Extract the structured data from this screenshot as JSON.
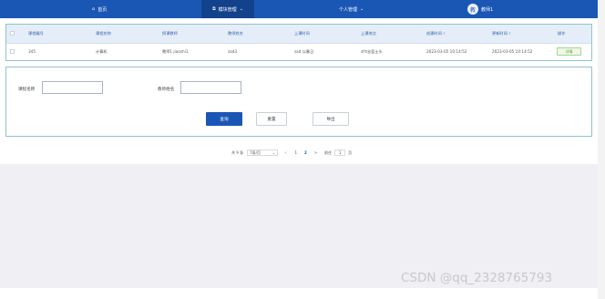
{
  "nav": {
    "home": "首页",
    "module": "模块管理",
    "personal": "个人管理",
    "avatar_initial": "教",
    "user": "教师1"
  },
  "table": {
    "headers": [
      "课程编号",
      "课程名称",
      "授课教师",
      "教师姓名",
      "上课时间",
      "上课地点",
      "创建时间",
      "更新时间",
      "操作"
    ],
    "row": {
      "id": "345",
      "course": "计算机",
      "teacher": "教师1 jiaoshi1",
      "teacher_name": "sad3",
      "time": "sad 以春日",
      "location": "sfrt去篮士头",
      "created": "2023-03-05 10:14:52",
      "updated": "2023-03-05 10:14:52",
      "action": "详情"
    }
  },
  "search": {
    "course_label": "课程名称",
    "teacher_label": "教师姓名",
    "course_value": "",
    "teacher_value": "",
    "query_btn": "查询",
    "reset_btn": "重置",
    "export_btn": "导出"
  },
  "pager": {
    "total": "共 9 条",
    "page_size": "7条/页",
    "prev": "<",
    "page1": "1",
    "page2": "2",
    "next": ">",
    "goto_label": "前往",
    "goto_value": "1",
    "goto_suffix": "页"
  },
  "watermark": "CSDN @qq_2328765793",
  "colors": {
    "topbar": "#1a57b5",
    "active_tab": "#13428c",
    "border": "#8fc3cf",
    "header_bg": "#e5edf8"
  }
}
